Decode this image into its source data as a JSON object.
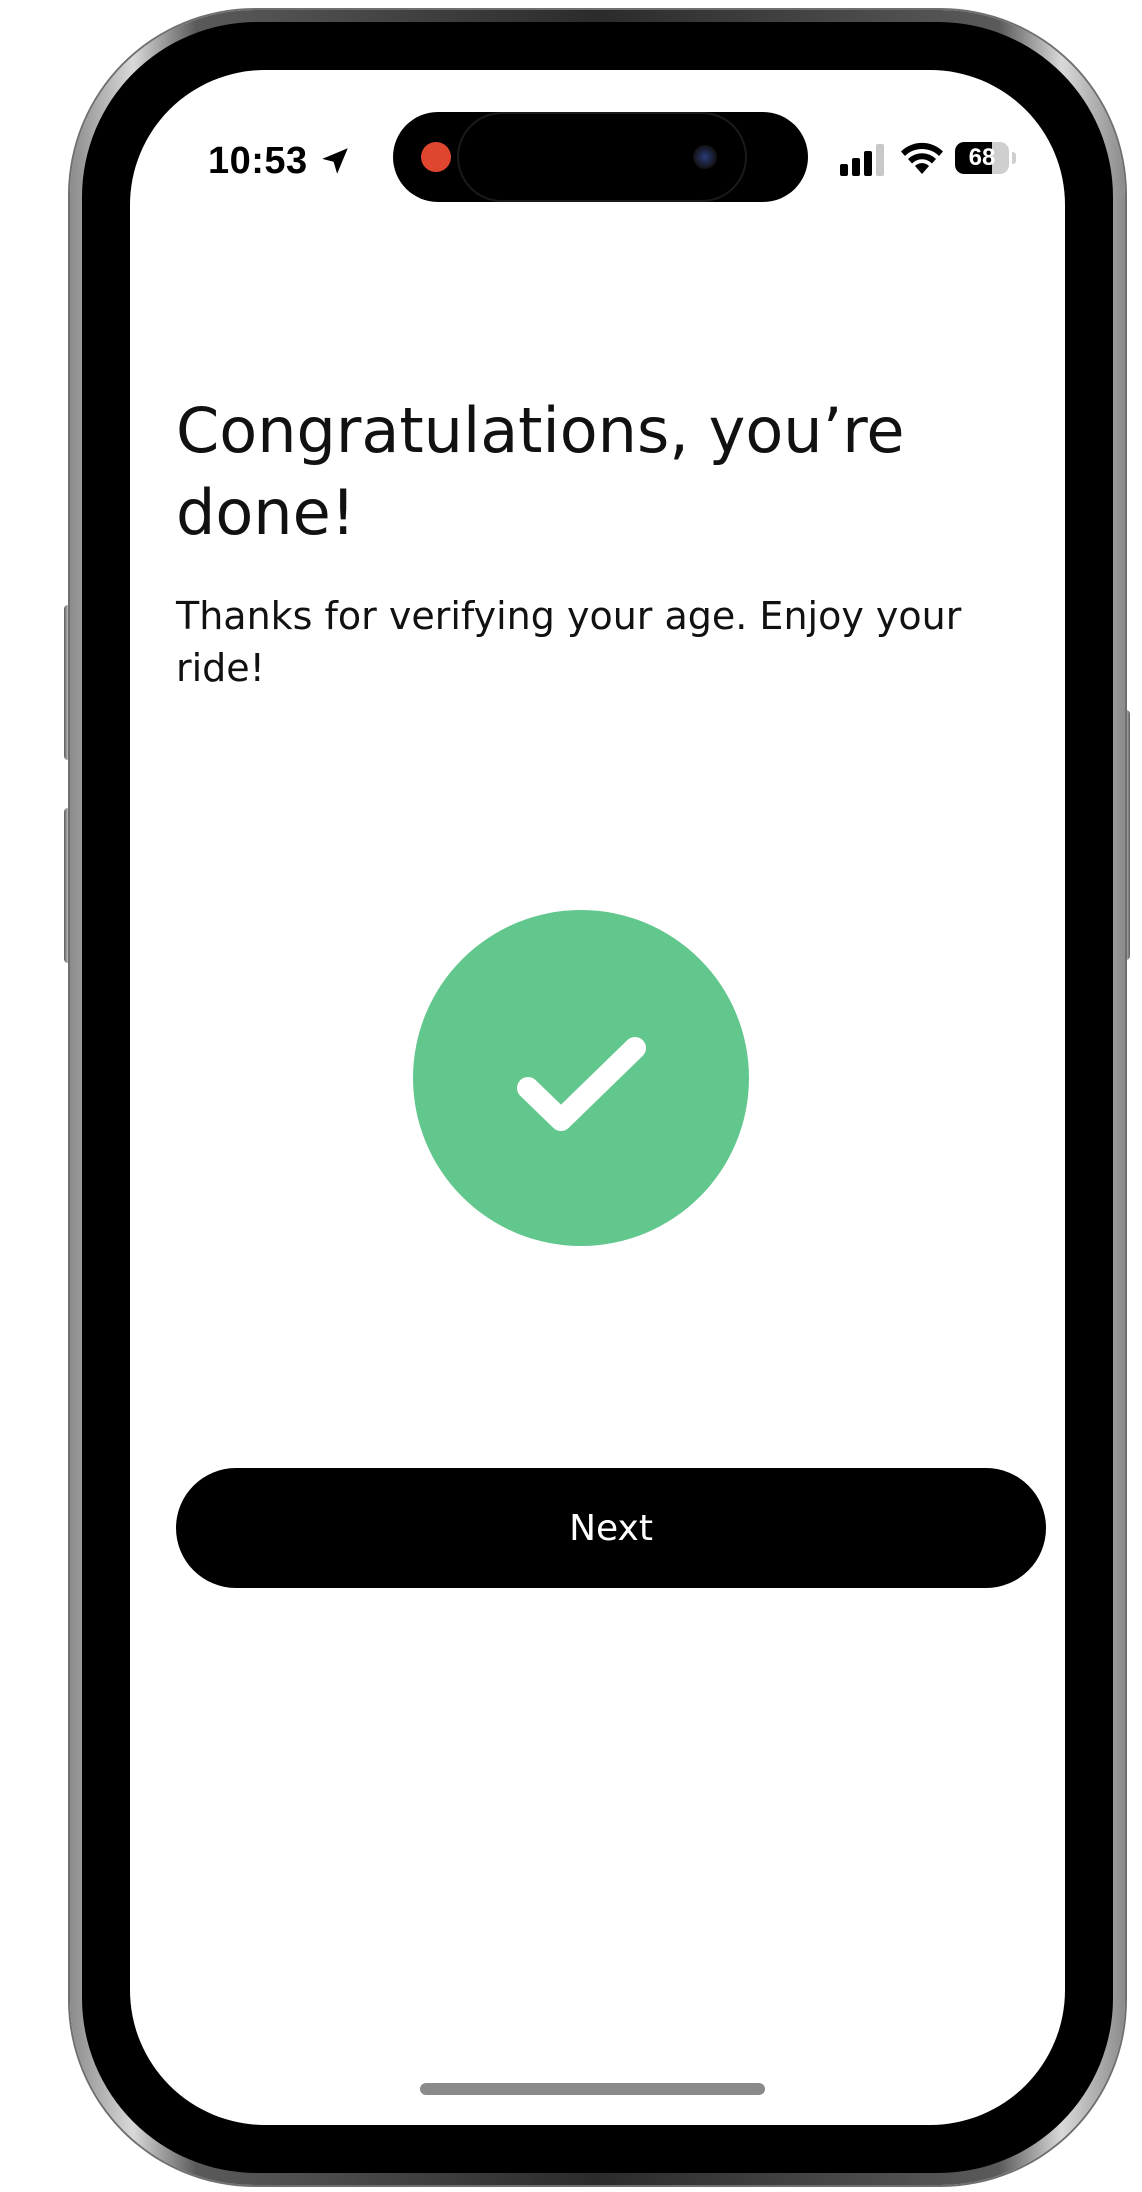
{
  "status_bar": {
    "time": "10:53",
    "battery_level": "68",
    "battery_fraction": 0.68
  },
  "icons": {
    "location": "location-arrow-icon",
    "signal": "cellular-signal-icon",
    "wifi": "wifi-icon",
    "battery": "battery-icon",
    "check": "checkmark-icon"
  },
  "colors": {
    "success_green": "#62c78c",
    "button_bg": "#000000",
    "recording_dot": "#e0462f"
  },
  "main": {
    "title": "Congratulations, you’re done!",
    "message": "Thanks for verifying your age. Enjoy your ride!",
    "next_label": "Next"
  }
}
